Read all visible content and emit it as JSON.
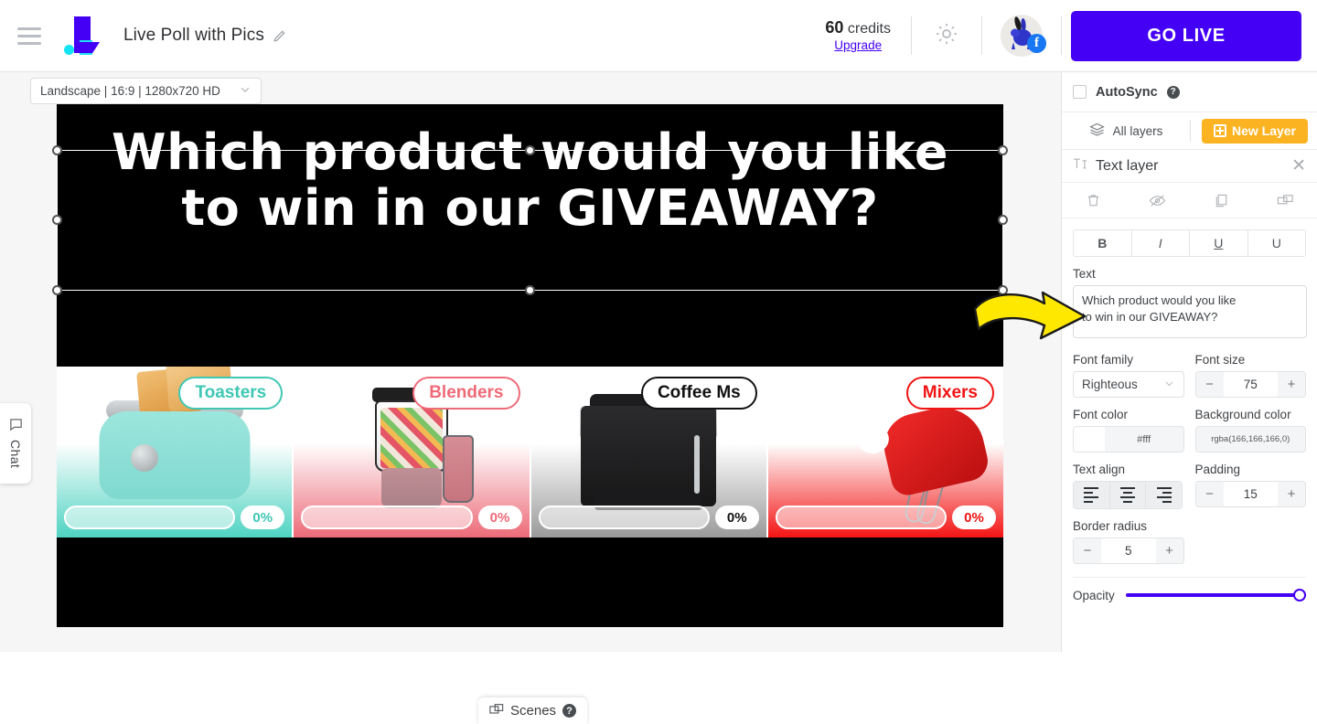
{
  "topbar": {
    "menu_icon": "hamburger-icon",
    "logo_icon": "brand-logo-icon",
    "project_title": "Live Poll with Pics",
    "edit_icon": "pencil-icon",
    "credits_count": "60",
    "credits_word": "credits",
    "upgrade_label": "Upgrade",
    "settings_icon": "gear-icon",
    "avatar_icon": "rabbit-avatar",
    "avatar_badge": "facebook-badge",
    "avatar_badge_glyph": "f",
    "go_live_label": "GO LIVE",
    "accent_color": "#4400f5"
  },
  "workarea": {
    "ratio_label": "Landscape | 16:9 | 1280x720 HD",
    "chat_label": "Chat",
    "chat_icon": "chat-bubble-icon",
    "scenes_label": "Scenes",
    "scenes_icon": "scenes-icon",
    "scenes_help": "?",
    "annotation_icon": "yellow-arrow-annotation"
  },
  "canvas": {
    "poll_title_line1": "Which product would you like",
    "poll_title_line2": "to win in our GIVEAWAY?",
    "background_color": "#000000",
    "options": [
      {
        "label": "Toasters",
        "percent": "0%",
        "tag_color": "#3fc7b4",
        "bg_top": "#ffffff",
        "bg_bottom": "#4fd3c2",
        "product_icon": "toaster-image"
      },
      {
        "label": "Blenders",
        "percent": "0%",
        "tag_color": "#ef6a78",
        "bg_top": "#ffffff",
        "bg_bottom": "#ec6b78",
        "product_icon": "blender-image"
      },
      {
        "label": "Coffee Ms",
        "percent": "0%",
        "tag_color": "#111111",
        "bg_top": "#ffffff",
        "bg_bottom": "#9a9a9a",
        "product_icon": "coffee-machine-image"
      },
      {
        "label": "Mixers",
        "percent": "0%",
        "tag_color": "#f01414",
        "bg_top": "#ffffff",
        "bg_bottom": "#f31414",
        "product_icon": "hand-mixer-image"
      }
    ]
  },
  "panel": {
    "autosync_label": "AutoSync",
    "autosync_help": "?",
    "autosync_checked": false,
    "all_layers_label": "All layers",
    "all_layers_icon": "layers-icon",
    "new_layer_label": "New Layer",
    "new_layer_icon": "plus-square-icon",
    "new_layer_color": "#fcb321",
    "layer_title": "Text layer",
    "layer_type_icon": "text-tool-icon",
    "close_icon": "close-icon",
    "actions": [
      {
        "name": "delete-layer",
        "icon": "trash-icon"
      },
      {
        "name": "hide-layer",
        "icon": "eye-off-icon"
      },
      {
        "name": "duplicate-layer",
        "icon": "duplicate-icon"
      },
      {
        "name": "move-layer-to-scene",
        "icon": "move-to-scene-icon"
      }
    ],
    "format_buttons": [
      {
        "name": "bold",
        "label": "B"
      },
      {
        "name": "italic",
        "label": "I"
      },
      {
        "name": "underline",
        "label": "U"
      },
      {
        "name": "underline-alt",
        "label": "U"
      }
    ],
    "text_field_label": "Text",
    "text_field_value": "Which product would you like\nto win in our GIVEAWAY?",
    "font_family_label": "Font family",
    "font_family_value": "Righteous",
    "font_size_label": "Font size",
    "font_size_value": "75",
    "font_color_label": "Font color",
    "font_color_value": "#fff",
    "background_color_label": "Background color",
    "background_color_value": "rgba(166,166,166,0)",
    "text_align_label": "Text align",
    "text_align_options": [
      "align-left",
      "align-center",
      "align-right"
    ],
    "text_align_selected": "align-left",
    "padding_label": "Padding",
    "padding_value": "15",
    "border_radius_label": "Border radius",
    "border_radius_value": "5",
    "opacity_label": "Opacity",
    "opacity_value": "100",
    "minus_glyph": "−",
    "plus_glyph": "+"
  }
}
